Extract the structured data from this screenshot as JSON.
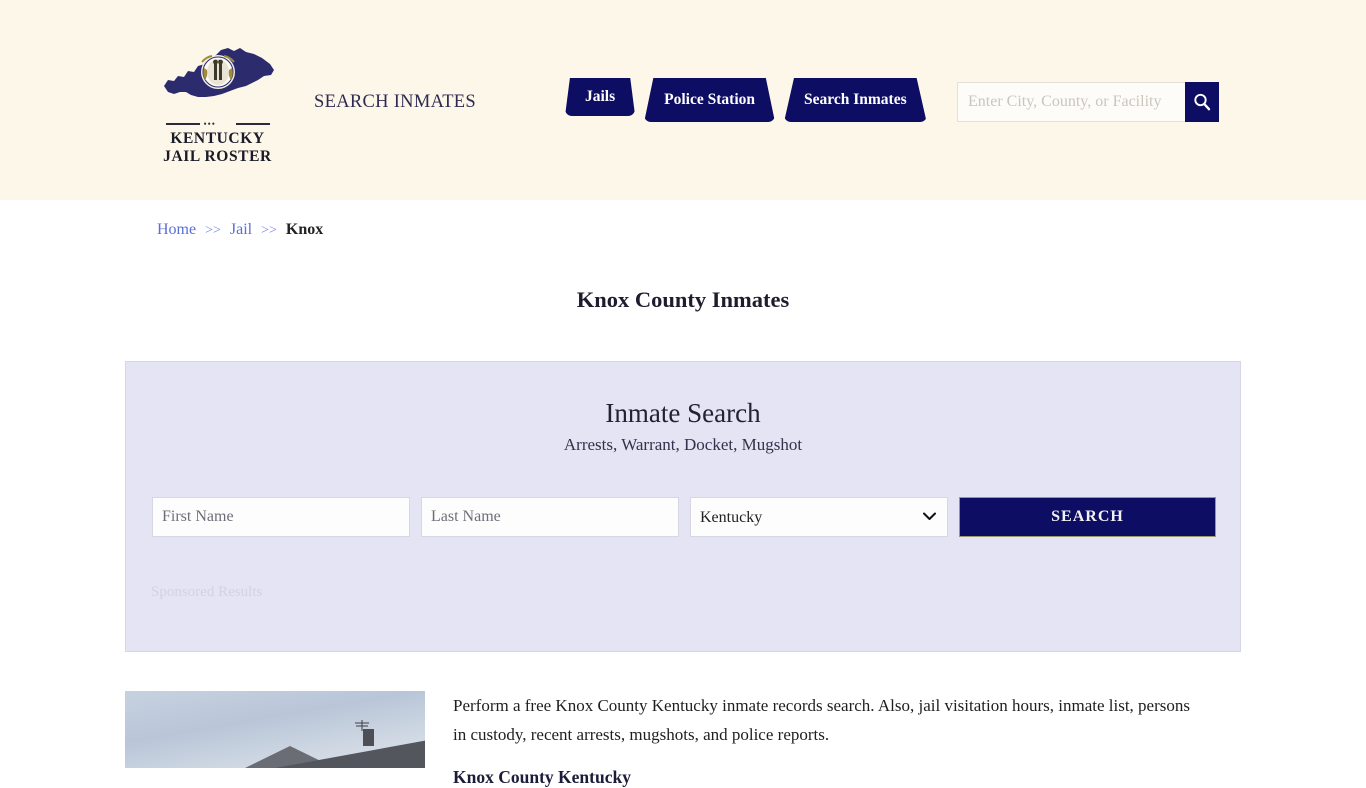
{
  "header": {
    "logo": {
      "line1": "KENTUCKY",
      "line2": "JAIL ROSTER",
      "dots": "•••",
      "icon": "kentucky-state-map-icon"
    },
    "tagline": "SEARCH INMATES",
    "nav": [
      {
        "label": "Jails",
        "name": "nav-jails"
      },
      {
        "label": "Police Station",
        "name": "nav-police-station"
      },
      {
        "label": "Search Inmates",
        "name": "nav-search-inmates"
      }
    ],
    "search": {
      "placeholder": "Enter City, County, or Facility",
      "value": "",
      "button_icon": "search-icon"
    }
  },
  "breadcrumb": {
    "home": "Home",
    "sep1": ">>",
    "jail": "Jail",
    "sep2": ">>",
    "current": "Knox"
  },
  "page": {
    "title": "Knox County Inmates"
  },
  "search_panel": {
    "title": "Inmate Search",
    "subtitle": "Arrests, Warrant, Docket, Mugshot",
    "first_name_placeholder": "First Name",
    "first_name_value": "",
    "last_name_placeholder": "Last Name",
    "last_name_value": "",
    "state_selected": "Kentucky",
    "state_options": [
      "Kentucky"
    ],
    "submit_label": "SEARCH",
    "sponsored_label": "Sponsored Results",
    "panel_bg": "#e4e4f4",
    "accent": "#0d0d63"
  },
  "content": {
    "photo_alt": "knox-county-jail-photo",
    "paragraph": "Perform a free Knox County Kentucky inmate records search. Also, jail visitation hours, inmate list, persons in custody, recent arrests, mugshots, and police reports.",
    "subheading": "Knox County Kentucky"
  }
}
